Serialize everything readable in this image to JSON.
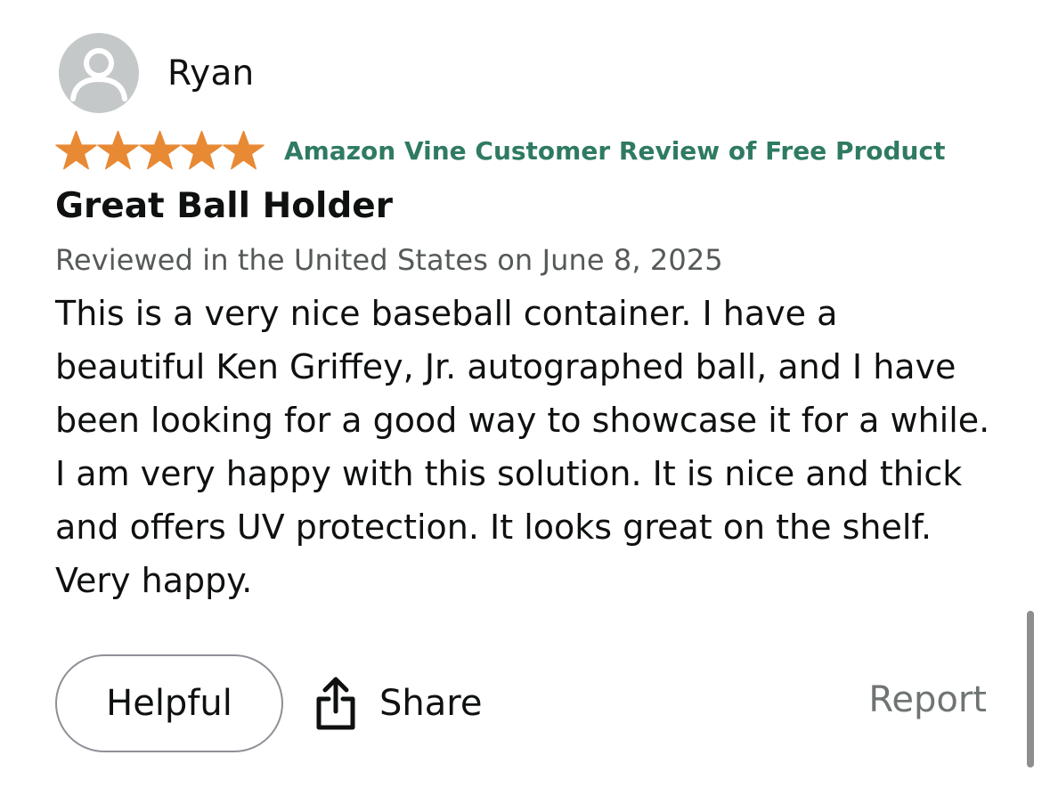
{
  "reviewer": {
    "name": "Ryan",
    "avatar_icon": "user-silhouette-icon"
  },
  "rating": {
    "stars": 5,
    "max_stars": 5,
    "star_color": "#e88934"
  },
  "vine_badge": {
    "label": "Amazon Vine Customer Review of Free Product",
    "color": "#2f7a63"
  },
  "review": {
    "title": "Great Ball Holder",
    "meta": "Reviewed in the United States on June 8, 2025",
    "body": "This is a very nice baseball container. I have a beautiful Ken Griffey, Jr. autographed ball, and I have been looking for a good way to showcase it for a while. I am very happy with this solution. It is nice and thick and offers UV protection. It looks great on the shelf. Very happy."
  },
  "actions": {
    "helpful_label": "Helpful",
    "share_label": "Share",
    "share_icon": "share-icon",
    "report_label": "Report"
  }
}
